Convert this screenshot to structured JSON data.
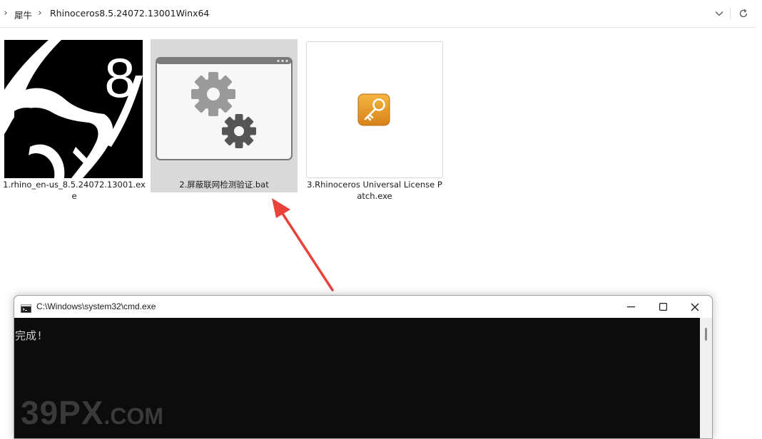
{
  "address_bar": {
    "segments": [
      "犀牛",
      "Rhinoceros8.5.24072.13001Winx64"
    ],
    "dropdown_icon": "chevron-down-icon",
    "refresh_icon": "refresh-icon"
  },
  "files": [
    {
      "name": "1.rhino_en-us_8.5.24072.13001.exe",
      "icon": "rhino-8-icon",
      "selected": false
    },
    {
      "name": "2.屏蔽联网检测验证.bat",
      "icon": "batch-file-gears-icon",
      "selected": true
    },
    {
      "name": "3.Rhinoceros Universal License Patch.exe",
      "icon": "key-icon",
      "selected": false
    }
  ],
  "cmd_window": {
    "title": "C:\\Windows\\system32\\cmd.exe",
    "output": "完成!",
    "watermark_big": "39PX",
    "watermark_small": ".COM"
  },
  "colors": {
    "selection": "#d9d9d9",
    "arrow": "#e8423a",
    "console_bg": "#0c0c0c",
    "key_orange": "#e49a1f"
  }
}
